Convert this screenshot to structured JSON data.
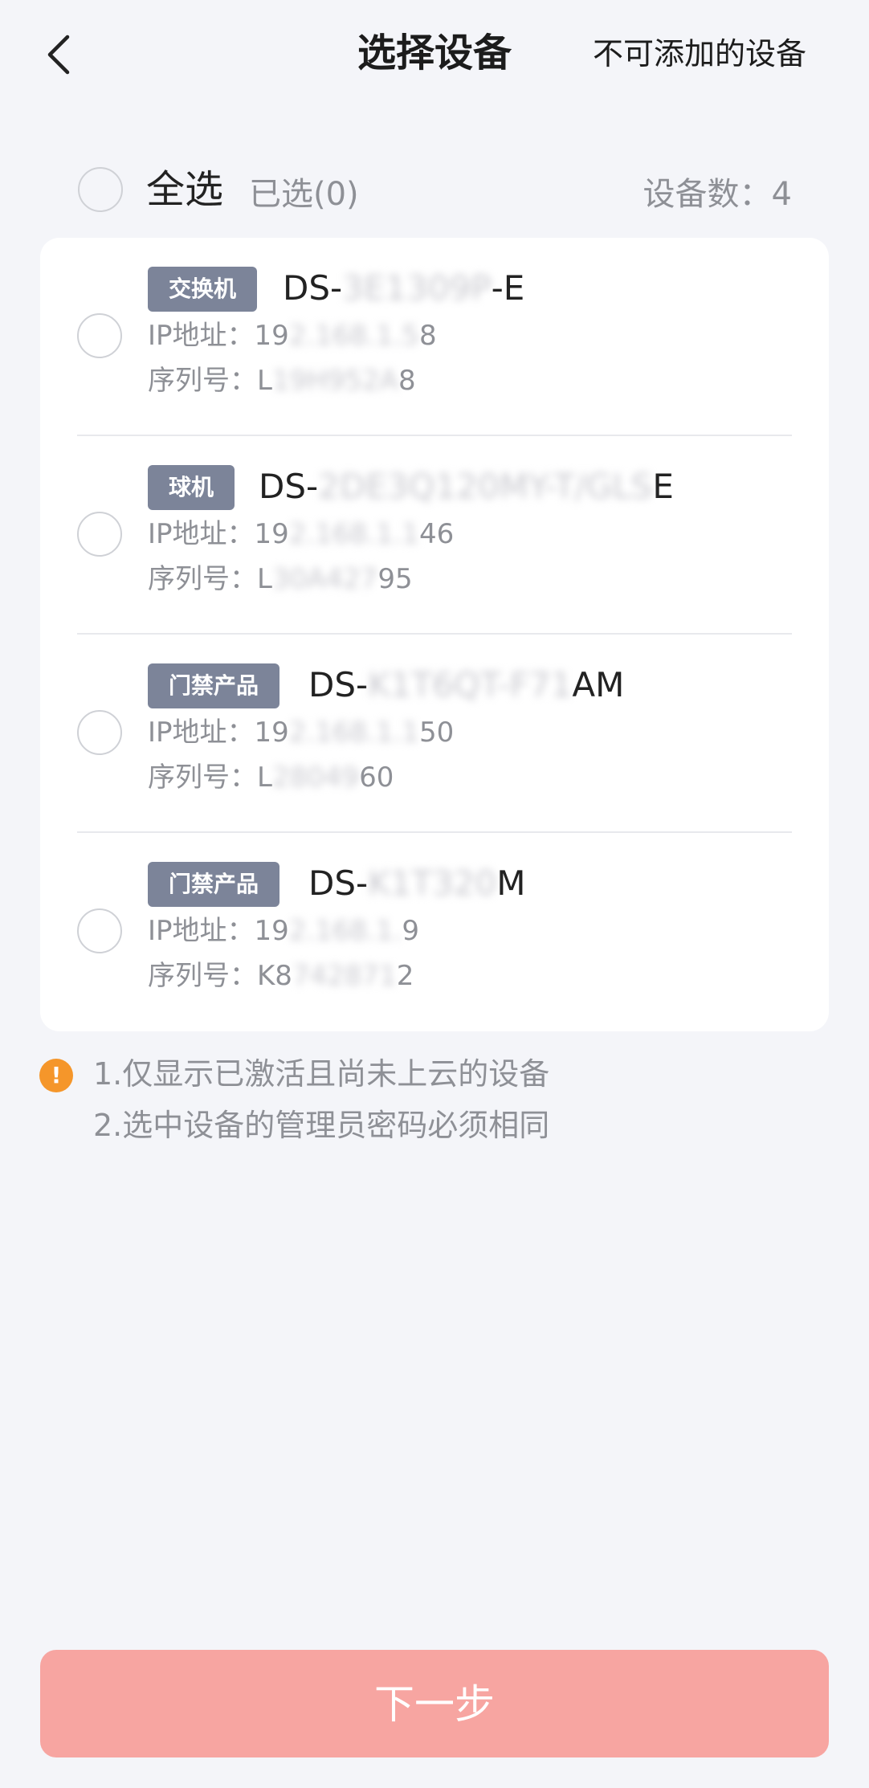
{
  "header": {
    "title": "选择设备",
    "right_link": "不可添加的设备"
  },
  "select_bar": {
    "select_all_label": "全选",
    "selected_text": "已选(0)",
    "device_count_text": "设备数：4"
  },
  "devices": [
    {
      "badge": "交换机",
      "model_prefix": "DS-",
      "model_hidden": "3E1309P",
      "model_suffix": "-E",
      "ip_label": "IP地址：",
      "ip_prefix": "19",
      "ip_hidden": "2.168.1.5",
      "ip_suffix": "8",
      "sn_label": "序列号：",
      "sn_prefix": "L",
      "sn_hidden": "19H952A",
      "sn_suffix": "8"
    },
    {
      "badge": "球机",
      "model_prefix": "DS-",
      "model_hidden": "2DE3Q120MY-T/GLS",
      "model_suffix": "E",
      "ip_label": "IP地址：",
      "ip_prefix": "19",
      "ip_hidden": "2.168.1.1",
      "ip_suffix": "46",
      "sn_label": "序列号：",
      "sn_prefix": "L",
      "sn_hidden": "30A427",
      "sn_suffix": "95"
    },
    {
      "badge": "门禁产品",
      "model_prefix": "DS-",
      "model_hidden": "K1T6QT-F71",
      "model_suffix": "AM",
      "ip_label": "IP地址：",
      "ip_prefix": "19",
      "ip_hidden": "2.168.1.1",
      "ip_suffix": "50",
      "sn_label": "序列号：",
      "sn_prefix": "L",
      "sn_hidden": "28049",
      "sn_suffix": "60"
    },
    {
      "badge": "门禁产品",
      "model_prefix": "DS-",
      "model_hidden": "K1T320",
      "model_suffix": "M",
      "ip_label": "IP地址：",
      "ip_prefix": "19",
      "ip_hidden": "2.168.1.",
      "ip_suffix": "9",
      "sn_label": "序列号：",
      "sn_prefix": "K8",
      "sn_hidden": "742871",
      "sn_suffix": "2"
    }
  ],
  "notice": {
    "icon": "!",
    "line1": "1.仅显示已激活且尚未上云的设备",
    "line2": "2.选中设备的管理员密码必须相同"
  },
  "footer": {
    "next_label": "下一步"
  },
  "colors": {
    "accent_disabled": "#f7a5a1",
    "badge": "#7c8499",
    "warning": "#f5962a"
  }
}
